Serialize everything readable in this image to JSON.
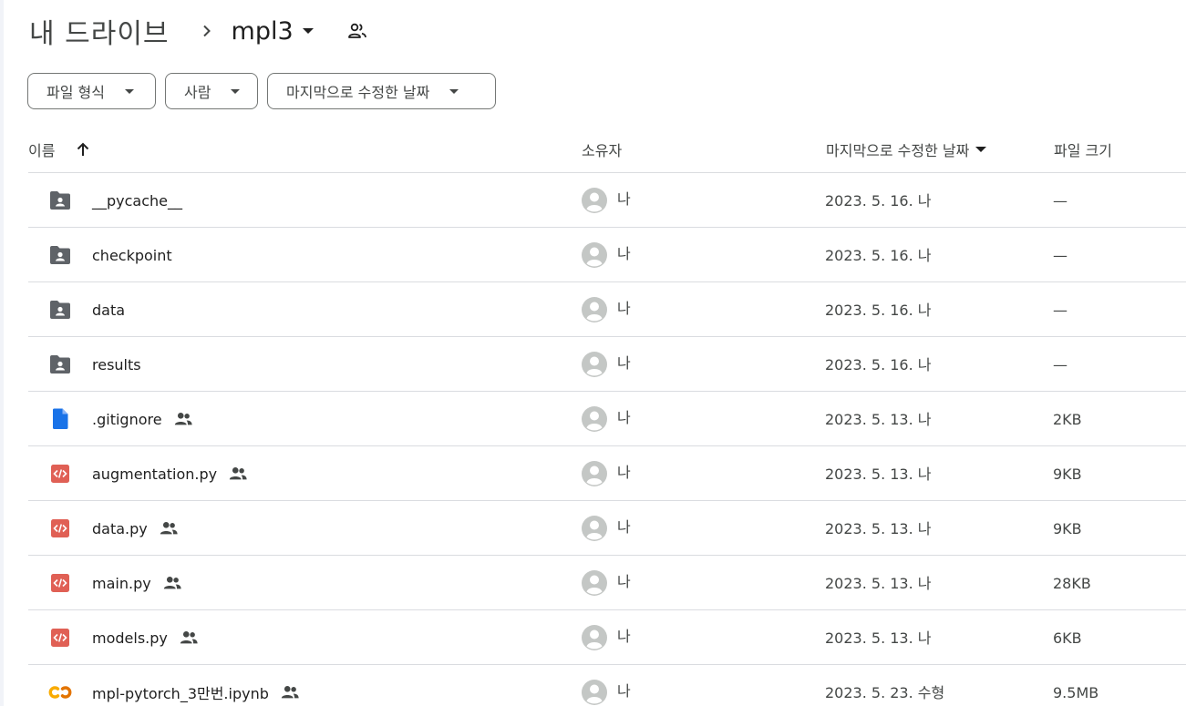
{
  "header": {
    "root_label": "내 드라이브",
    "current_folder": "mpl3"
  },
  "filters": [
    {
      "label": "파일 형식"
    },
    {
      "label": "사람"
    },
    {
      "label": "마지막으로 수정한 날짜"
    }
  ],
  "columns": {
    "name": "이름",
    "owner": "소유자",
    "modified": "마지막으로 수정한 날짜",
    "size": "파일 크기"
  },
  "rows": [
    {
      "name": "__pycache__",
      "type": "folder",
      "shared": false,
      "owner": "나",
      "modified": "2023. 5. 16. 나",
      "size": "—"
    },
    {
      "name": "checkpoint",
      "type": "folder",
      "shared": false,
      "owner": "나",
      "modified": "2023. 5. 16. 나",
      "size": "—"
    },
    {
      "name": "data",
      "type": "folder",
      "shared": false,
      "owner": "나",
      "modified": "2023. 5. 16. 나",
      "size": "—"
    },
    {
      "name": "results",
      "type": "folder",
      "shared": false,
      "owner": "나",
      "modified": "2023. 5. 16. 나",
      "size": "—"
    },
    {
      "name": ".gitignore",
      "type": "doc",
      "shared": true,
      "owner": "나",
      "modified": "2023. 5. 13. 나",
      "size": "2KB"
    },
    {
      "name": "augmentation.py",
      "type": "code",
      "shared": true,
      "owner": "나",
      "modified": "2023. 5. 13. 나",
      "size": "9KB"
    },
    {
      "name": "data.py",
      "type": "code",
      "shared": true,
      "owner": "나",
      "modified": "2023. 5. 13. 나",
      "size": "9KB"
    },
    {
      "name": "main.py",
      "type": "code",
      "shared": true,
      "owner": "나",
      "modified": "2023. 5. 13. 나",
      "size": "28KB"
    },
    {
      "name": "models.py",
      "type": "code",
      "shared": true,
      "owner": "나",
      "modified": "2023. 5. 13. 나",
      "size": "6KB"
    },
    {
      "name": "mpl-pytorch_3만번.ipynb",
      "type": "colab",
      "shared": true,
      "owner": "나",
      "modified": "2023. 5. 23. 수형",
      "size": "9.5MB"
    }
  ],
  "icons": {
    "folder": "shared-folder-icon",
    "doc": "text-file-icon",
    "code": "code-file-icon",
    "colab": "colab-notebook-icon",
    "shared": "shared-people-icon",
    "avatar": "default-avatar-icon"
  },
  "colors": {
    "folder": "#5f6368",
    "doc": "#1a73e8",
    "code": "#e06055",
    "colab": "#f9ab00",
    "divider": "#dadce0",
    "chip_border": "#747775",
    "avatar": "#c4c7c5"
  }
}
